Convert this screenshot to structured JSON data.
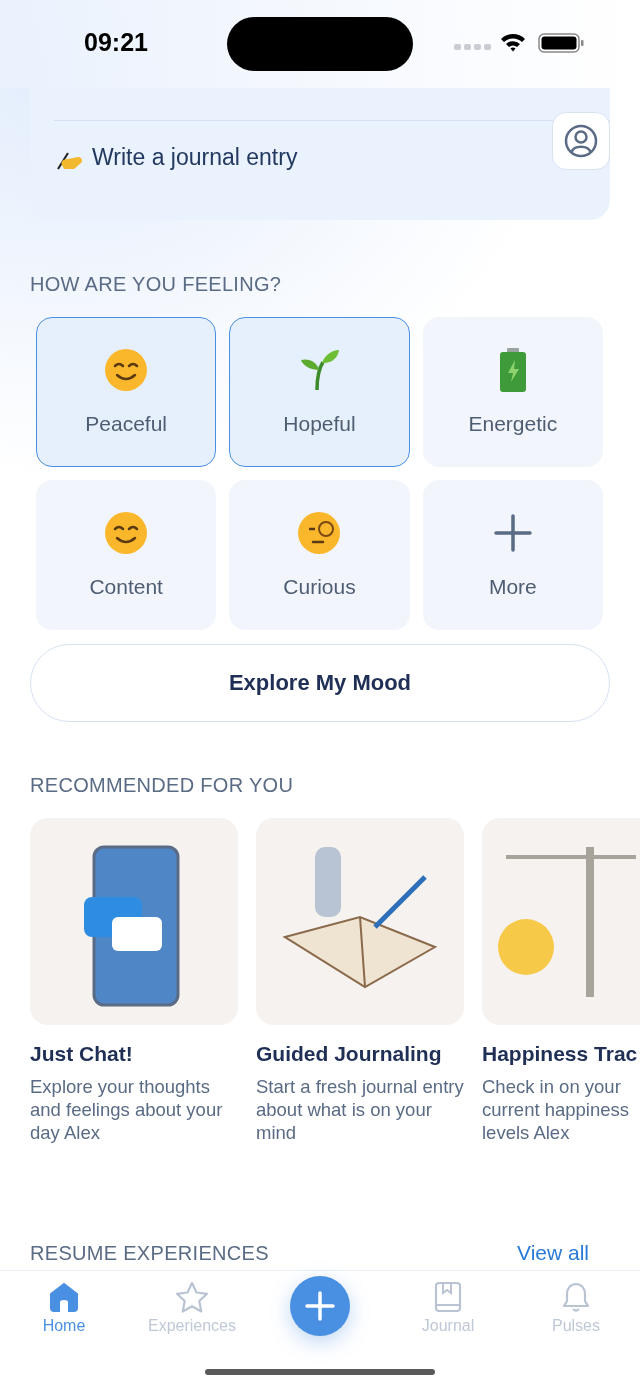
{
  "status_bar": {
    "time": "09:21"
  },
  "quick_actions": [
    {
      "label": "Write a journal entry"
    }
  ],
  "feelings": {
    "heading": "HOW ARE YOU FEELING?",
    "items": [
      {
        "kind": "mood",
        "label": "Peaceful",
        "selected": true
      },
      {
        "kind": "mood",
        "label": "Hopeful",
        "selected": true
      },
      {
        "kind": "mood",
        "label": "Energetic",
        "selected": false
      },
      {
        "kind": "mood",
        "label": "Content",
        "selected": false
      },
      {
        "kind": "mood",
        "label": "Curious",
        "selected": false
      },
      {
        "kind": "more",
        "label": "More",
        "selected": false
      }
    ],
    "button": "Explore My Mood"
  },
  "recommended": {
    "heading": "RECOMMENDED FOR YOU",
    "cards": [
      {
        "title": "Just Chat!",
        "description": "Explore your thoughts and feelings about your day Alex"
      },
      {
        "title": "Guided Journaling",
        "description": "Start a fresh journal entry about what is on your mind"
      },
      {
        "title": "Happiness Trac",
        "description": "Check in on your current happiness levels Alex"
      }
    ]
  },
  "resume": {
    "heading": "RESUME EXPERIENCES",
    "link": "View all"
  },
  "tab_bar": [
    {
      "label": "Home",
      "selected": true
    },
    {
      "label": "Experiences",
      "selected": false
    },
    {
      "label": "Journal",
      "selected": false
    },
    {
      "label": "Pulses",
      "selected": false
    }
  ]
}
